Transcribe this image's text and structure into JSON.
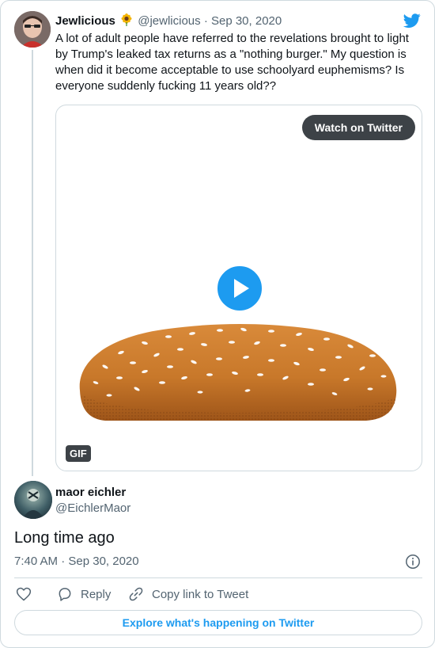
{
  "tweet": {
    "author_name": "Jewlicious",
    "author_emoji": "sunflower",
    "author_handle": "@jewlicious",
    "separator": "·",
    "date": "Sep 30, 2020",
    "text": "A lot of adult people have referred to the revelations brought to light by Trump's leaked tax returns as a \"nothing burger.\" My question is when did it become acceptable to use schoolyard euphemisms? Is everyone suddenly fucking 11 years old??",
    "media": {
      "watch_label": "Watch on Twitter",
      "badge": "GIF"
    }
  },
  "reply": {
    "author_name": "maor eichler",
    "author_handle": "@EichlerMaor",
    "text": "Long time ago",
    "timestamp": "7:40 AM · Sep 30, 2020"
  },
  "actions": {
    "reply_label": "Reply",
    "copy_link_label": "Copy link to Tweet"
  },
  "explore_label": "Explore what's happening on Twitter",
  "colors": {
    "brand": "#1d9bf0",
    "text": "#0f1419",
    "muted": "#536471",
    "border": "#cfd9de",
    "bun": "#c8782a"
  }
}
